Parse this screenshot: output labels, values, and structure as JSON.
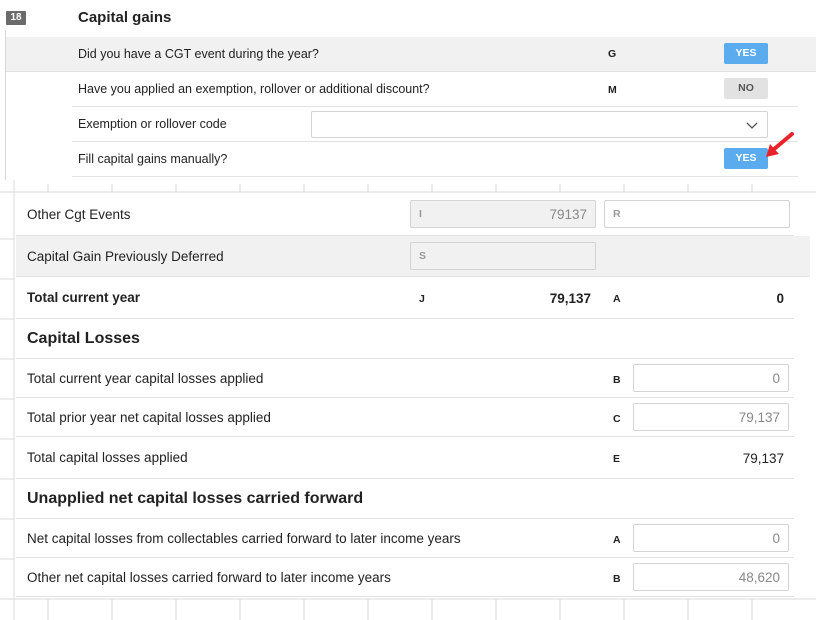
{
  "section": {
    "number": "18",
    "title": "Capital gains"
  },
  "questions": [
    {
      "label": "Did you have a CGT event during the year?",
      "code": "G",
      "value": "YES"
    },
    {
      "label": "Have you applied an exemption, rollover or additional discount?",
      "code": "M",
      "value": "NO"
    },
    {
      "label": "Exemption or rollover code",
      "selected": ""
    },
    {
      "label": "Fill capital gains manually?",
      "value": "YES"
    }
  ],
  "gains": {
    "other_cgt": {
      "label": "Other Cgt Events",
      "field_i_letter": "I",
      "field_i_value": "79137",
      "field_r_letter": "R",
      "field_r_value": ""
    },
    "deferred": {
      "label": "Capital Gain Previously Deferred",
      "field_s_letter": "S",
      "field_s_value": ""
    },
    "total": {
      "label": "Total current year",
      "code_j": "J",
      "value_j": "79,137",
      "code_a": "A",
      "value_a": "0"
    }
  },
  "losses": {
    "heading": "Capital Losses",
    "rows": [
      {
        "label": "Total current year capital losses applied",
        "code": "B",
        "value": "0"
      },
      {
        "label": "Total prior year net capital losses applied",
        "code": "C",
        "value": "79,137"
      },
      {
        "label": "Total capital losses applied",
        "code": "E",
        "value": "79,137"
      }
    ]
  },
  "carried_forward": {
    "heading": "Unapplied net capital losses carried forward",
    "rows": [
      {
        "label": "Net capital losses from collectables carried forward to later income years",
        "code": "A",
        "value": "0"
      },
      {
        "label": "Other net capital losses carried forward to later income years",
        "code": "B",
        "value": "48,620"
      }
    ]
  },
  "colors": {
    "yes_button": "#5aacef",
    "no_button": "#e2e2e2",
    "shaded_row": "#f1f1f1",
    "arrow": "#e8232a"
  }
}
